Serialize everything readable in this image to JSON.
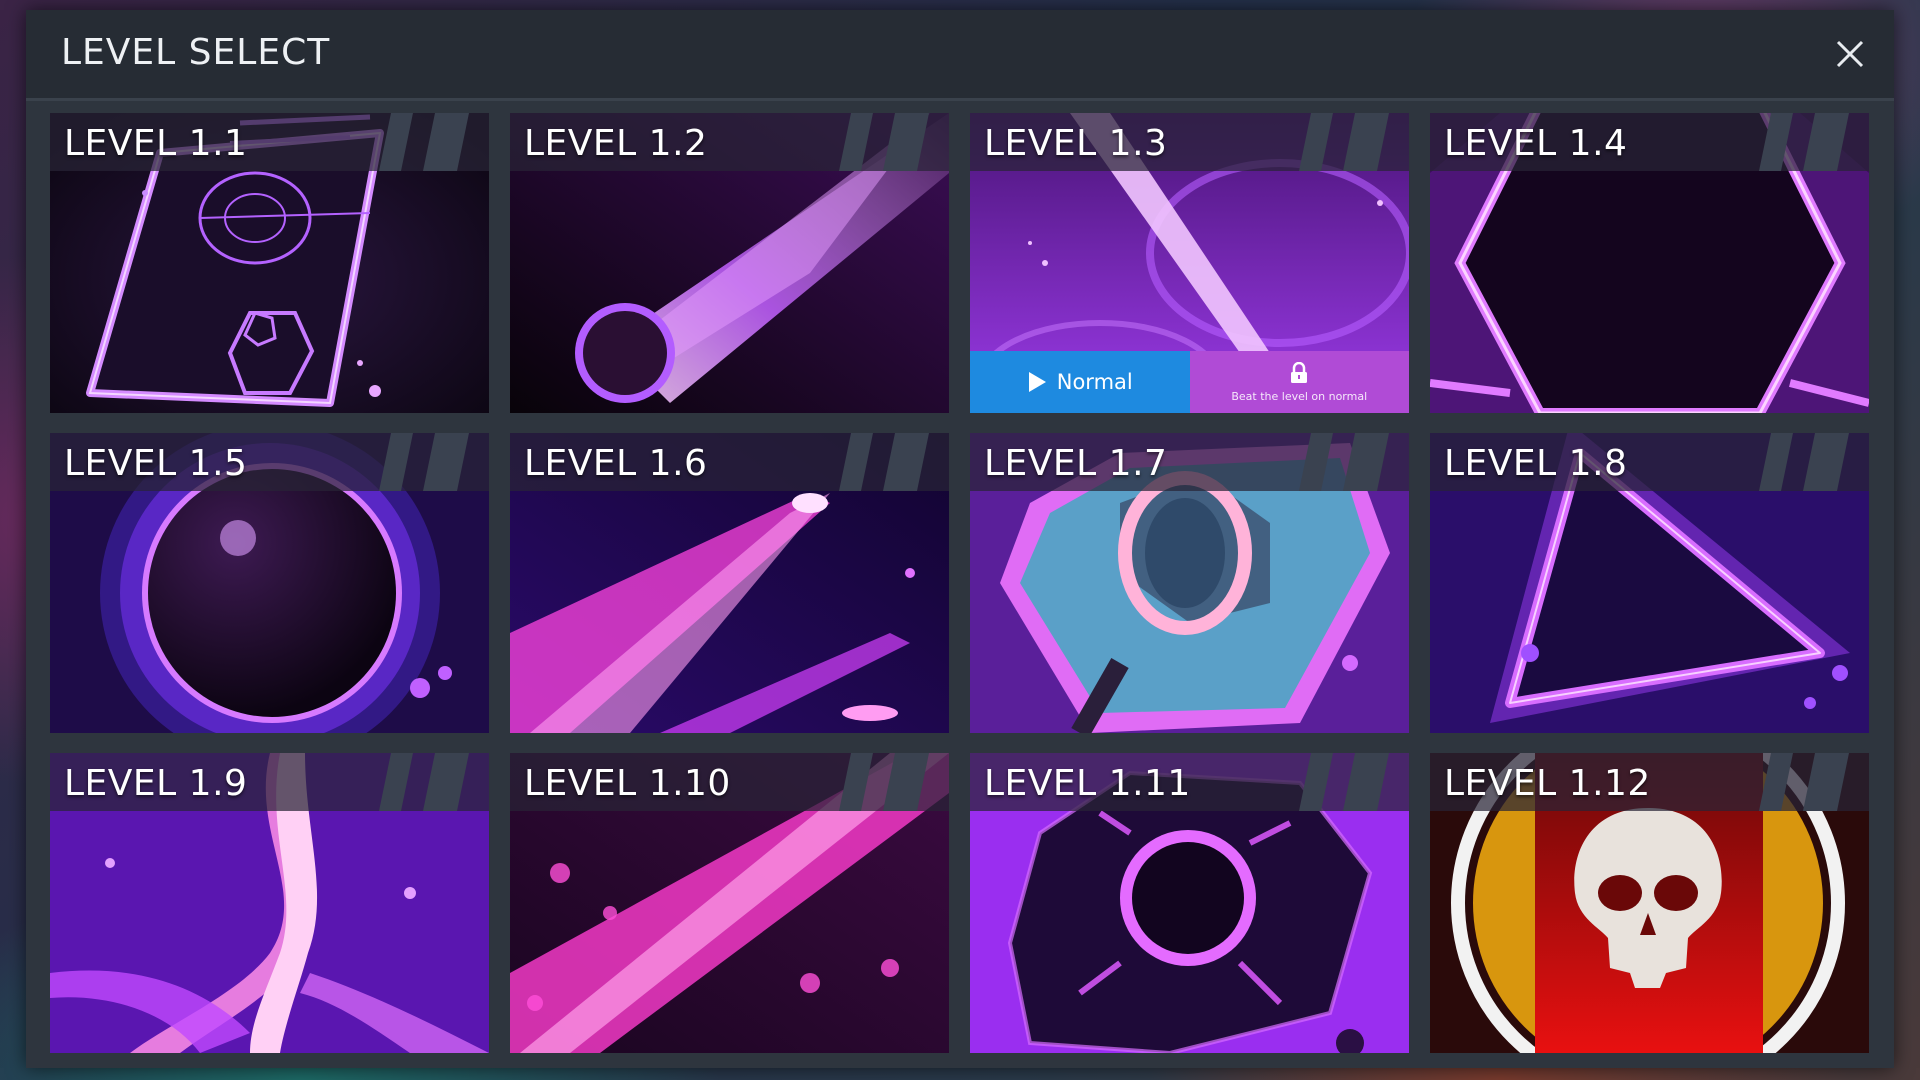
{
  "dialog": {
    "title": "LEVEL SELECT",
    "close_icon": "close-icon"
  },
  "levels": [
    {
      "name": "LEVEL 1.1",
      "art": "tablet-target"
    },
    {
      "name": "LEVEL 1.2",
      "art": "meteor"
    },
    {
      "name": "LEVEL 1.3",
      "art": "beam",
      "selected": true
    },
    {
      "name": "LEVEL 1.4",
      "art": "hexagon"
    },
    {
      "name": "LEVEL 1.5",
      "art": "sphere"
    },
    {
      "name": "LEVEL 1.6",
      "art": "streak"
    },
    {
      "name": "LEVEL 1.7",
      "art": "ring-hex"
    },
    {
      "name": "LEVEL 1.8",
      "art": "triangle"
    },
    {
      "name": "LEVEL 1.9",
      "art": "flow"
    },
    {
      "name": "LEVEL 1.10",
      "art": "comet"
    },
    {
      "name": "LEVEL 1.11",
      "art": "asteroid"
    },
    {
      "name": "LEVEL 1.12",
      "art": "skull"
    }
  ],
  "selected_actions": {
    "play_label": "Normal",
    "play_icon": "play-icon",
    "locked_label": "Beat the level on normal",
    "locked_icon": "lock-icon"
  },
  "colors": {
    "panel": "#2e353e",
    "header": "#262c34",
    "play_button": "#1e8ae0",
    "locked_button": "#b04bd6",
    "neon_purple": "#b23bff",
    "neon_pink": "#ff7be8"
  }
}
